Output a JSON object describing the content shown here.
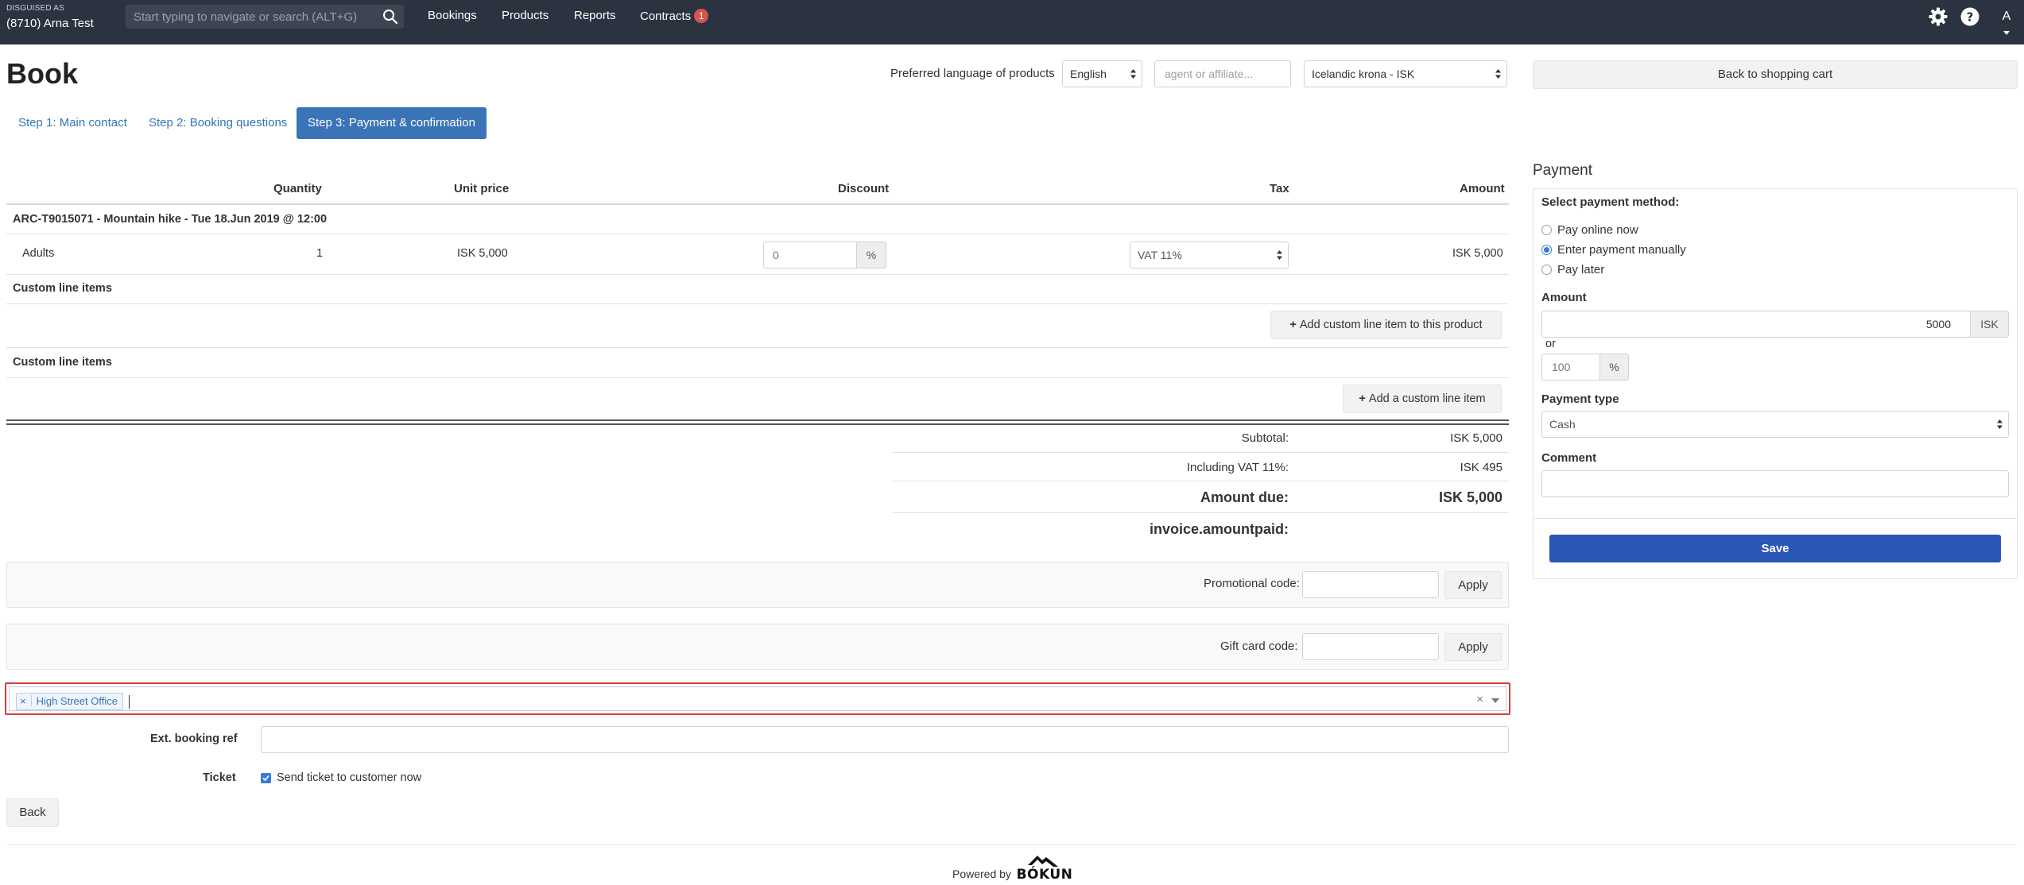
{
  "topbar": {
    "disguised_label": "DISGUISED AS",
    "account": "(8710) Arna Test",
    "search_placeholder": "Start typing to navigate or search (ALT+G)",
    "nav": [
      "Bookings",
      "Products",
      "Reports",
      "Contracts"
    ],
    "contracts_badge": "1",
    "avatar_initial": "A",
    "icons": [
      "search-icon",
      "gear-icon",
      "help-icon",
      "chevron-down-icon"
    ]
  },
  "header": {
    "title": "Book",
    "pref_lang_label": "Preferred language of products",
    "language_value": "English",
    "agent_placeholder": "agent or affiliate...",
    "currency_value": "Icelandic krona - ISK",
    "back_cart": "Back to shopping cart"
  },
  "steps": [
    {
      "label": "Step 1: Main contact",
      "active": false
    },
    {
      "label": "Step 2: Booking questions",
      "active": false
    },
    {
      "label": "Step 3: Payment & confirmation",
      "active": true
    }
  ],
  "table": {
    "headers": [
      "Quantity",
      "Unit price",
      "Discount",
      "Tax",
      "Amount"
    ],
    "product_line": "ARC-T9015071  -  Mountain hike - Tue 18.Jun 2019 @ 12:00",
    "row": {
      "label": "Adults",
      "quantity": "1",
      "unit_price": "ISK 5,000",
      "discount": "0",
      "discount_unit": "%",
      "tax": "VAT 11%",
      "amount": "ISK 5,000"
    },
    "custom_items_label": "Custom line items",
    "add_custom_product": "Add custom line item to this product",
    "custom_items_label_2": "Custom line items",
    "add_custom": "Add a custom line item"
  },
  "totals": {
    "subtotal_label": "Subtotal:",
    "subtotal": "ISK 5,000",
    "vat_label": "Including VAT 11%:",
    "vat": "ISK 495",
    "due_label": "Amount due:",
    "due": "ISK 5,000",
    "paid_label": "invoice.amountpaid:"
  },
  "codes": {
    "promo_label": "Promotional code:",
    "gift_label": "Gift card code:",
    "apply": "Apply"
  },
  "tags": {
    "selected": "High Street Office",
    "remove": "×",
    "clear": "×"
  },
  "extra": {
    "ext_ref_label": "Ext. booking ref",
    "ticket_label": "Ticket",
    "send_ticket": "Send ticket to customer now",
    "send_ticket_checked": true,
    "back": "Back"
  },
  "payment": {
    "title": "Payment",
    "method_label": "Select payment method:",
    "methods": [
      {
        "label": "Pay online now",
        "selected": false
      },
      {
        "label": "Enter payment manually",
        "selected": true
      },
      {
        "label": "Pay later",
        "selected": false
      }
    ],
    "amount_label": "Amount",
    "amount": "5000",
    "currency": "ISK",
    "or": "or",
    "percent": "100",
    "percent_unit": "%",
    "type_label": "Payment type",
    "type_value": "Cash",
    "comment_label": "Comment",
    "save": "Save"
  },
  "footer": {
    "powered_by": "Powered by",
    "logo_text": "BÓKUN"
  },
  "colors": {
    "topbar": "#2c3340",
    "accent": "#3a74b6",
    "save": "#2956b7",
    "highlight_border": "#d23f3f"
  }
}
